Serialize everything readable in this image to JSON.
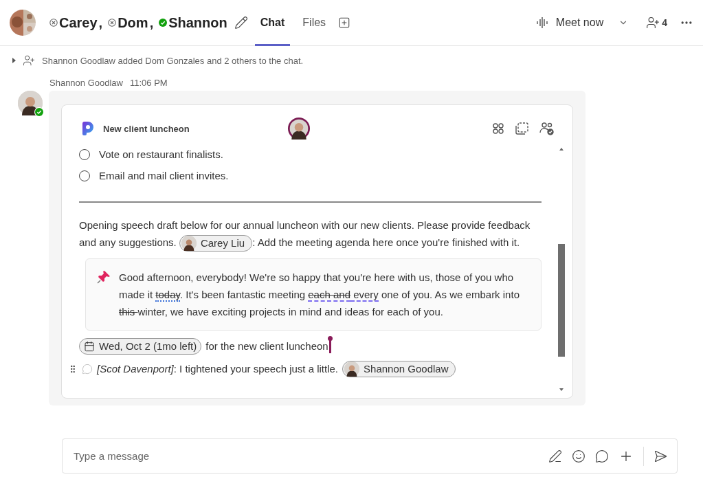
{
  "header": {
    "participants": [
      {
        "name": "Carey",
        "available": false,
        "separator": ","
      },
      {
        "name": "Dom",
        "available": false,
        "separator": ","
      },
      {
        "name": "Shannon",
        "available": true
      }
    ],
    "tabs": [
      {
        "label": "Chat",
        "selected": true
      },
      {
        "label": "Files",
        "selected": false
      }
    ],
    "meet_now": "Meet now",
    "people_count": "4"
  },
  "system_message": {
    "text": "Shannon Goodlaw added Dom Gonzales and 2 others to the chat.",
    "expanded": false
  },
  "message": {
    "author": "Shannon Goodlaw",
    "time": "11:06 PM",
    "available": true,
    "loop": {
      "title": "New client luncheon",
      "tasks": [
        {
          "text": "Vote on restaurant finalists.",
          "checked": false
        },
        {
          "text": "Email and mail client invites.",
          "checked": false
        }
      ],
      "paragraph": [
        {
          "kind": "text",
          "text": "Opening speech draft below for our annual luncheon with our new clients. Please provide feedback and any suggestions. "
        },
        {
          "kind": "mention",
          "text": "Carey Liu"
        },
        {
          "kind": "text",
          "text": ": Add the meeting agenda here once you're finished with it."
        }
      ],
      "quote": [
        {
          "kind": "plain",
          "text": "Good afternoon, everybody! We're so happy that you're here with us, those of you who made it "
        },
        {
          "kind": "struck-dotted",
          "text": "today"
        },
        {
          "kind": "plain",
          "text": ". It's been fantastic meeting "
        },
        {
          "kind": "struck-dashed",
          "text": "each and"
        },
        {
          "kind": "dashed",
          "text": " every"
        },
        {
          "kind": "plain",
          "text": " one of you. As we embark into "
        },
        {
          "kind": "struck",
          "text": "this "
        },
        {
          "kind": "plain",
          "text": "winter, we have exciting projects in mind and ideas for each of you."
        }
      ],
      "date_chip": "Wed, Oct 2 (1mo left)",
      "date_text": " for the new client luncheon",
      "comment": {
        "author": "[Scot Davenport]",
        "text": ": I tightened your speech just a little.",
        "mention": "Shannon Goodlaw"
      }
    }
  },
  "compose": {
    "placeholder": "Type a message"
  }
}
